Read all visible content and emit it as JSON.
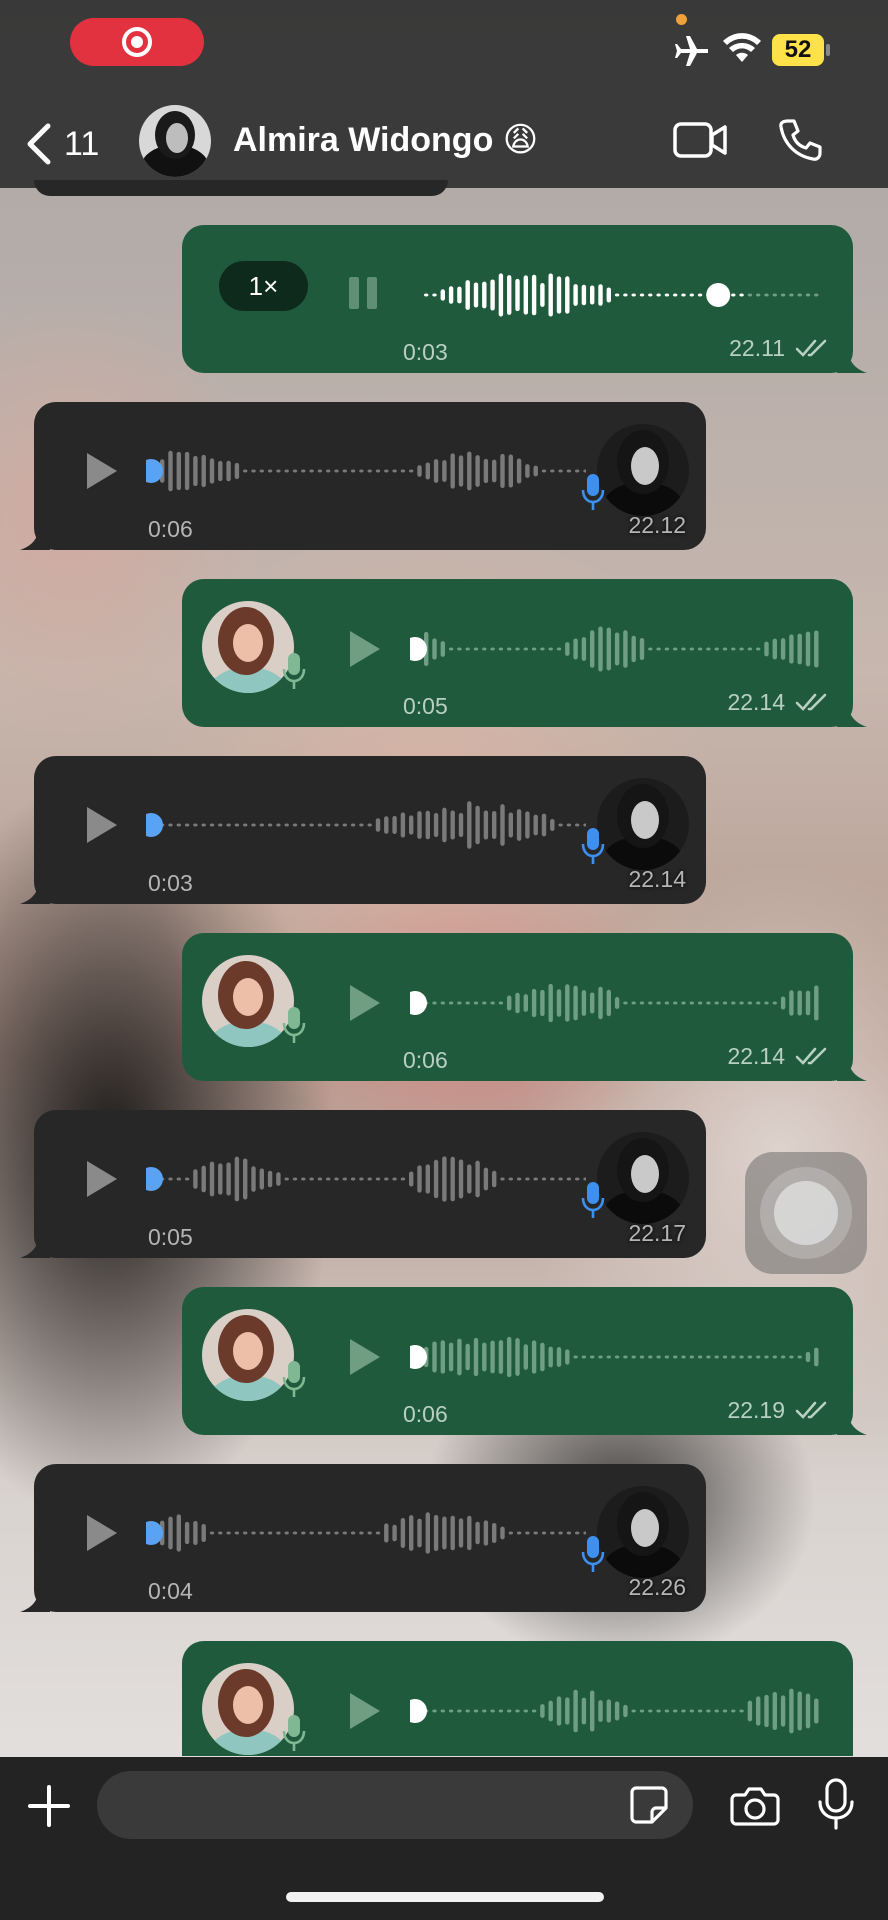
{
  "status_bar": {
    "battery_level": "52"
  },
  "header": {
    "back_count": "11",
    "contact_name": "Almira Widongo 😩"
  },
  "messages": [
    {
      "direction": "out",
      "state": "playing",
      "speed": "1×",
      "duration": "0:03",
      "time": "22.11",
      "read": true,
      "progress": 0.78
    },
    {
      "direction": "in",
      "state": "paused",
      "duration": "0:06",
      "time": "22.12",
      "progress": 0
    },
    {
      "direction": "out",
      "state": "paused",
      "duration": "0:05",
      "time": "22.14",
      "read": true,
      "progress": 0
    },
    {
      "direction": "in",
      "state": "paused",
      "duration": "0:03",
      "time": "22.14",
      "progress": 0
    },
    {
      "direction": "out",
      "state": "paused",
      "duration": "0:06",
      "time": "22.14",
      "read": true,
      "progress": 0
    },
    {
      "direction": "in",
      "state": "paused",
      "duration": "0:05",
      "time": "22.17",
      "progress": 0
    },
    {
      "direction": "out",
      "state": "paused",
      "duration": "0:06",
      "time": "22.19",
      "read": true,
      "progress": 0
    },
    {
      "direction": "in",
      "state": "paused",
      "duration": "0:04",
      "time": "22.26",
      "progress": 0
    },
    {
      "direction": "out",
      "state": "paused",
      "duration": "",
      "time": "",
      "read": true,
      "progress": 0
    }
  ],
  "composer": {
    "placeholder": ""
  },
  "colors": {
    "outgoing_bubble": "#1f5a3c",
    "incoming_bubble": "#272727",
    "unplayed_dot": "#5aa2f2",
    "record_pill": "#e2323f",
    "battery": "#ffe14a"
  },
  "icons": [
    "record-icon",
    "airplane-icon",
    "wifi-icon",
    "back-chevron-icon",
    "video-call-icon",
    "phone-icon",
    "play-icon",
    "pause-icon",
    "mic-icon",
    "read-ticks-icon",
    "plus-icon",
    "sticker-icon",
    "camera-icon"
  ]
}
